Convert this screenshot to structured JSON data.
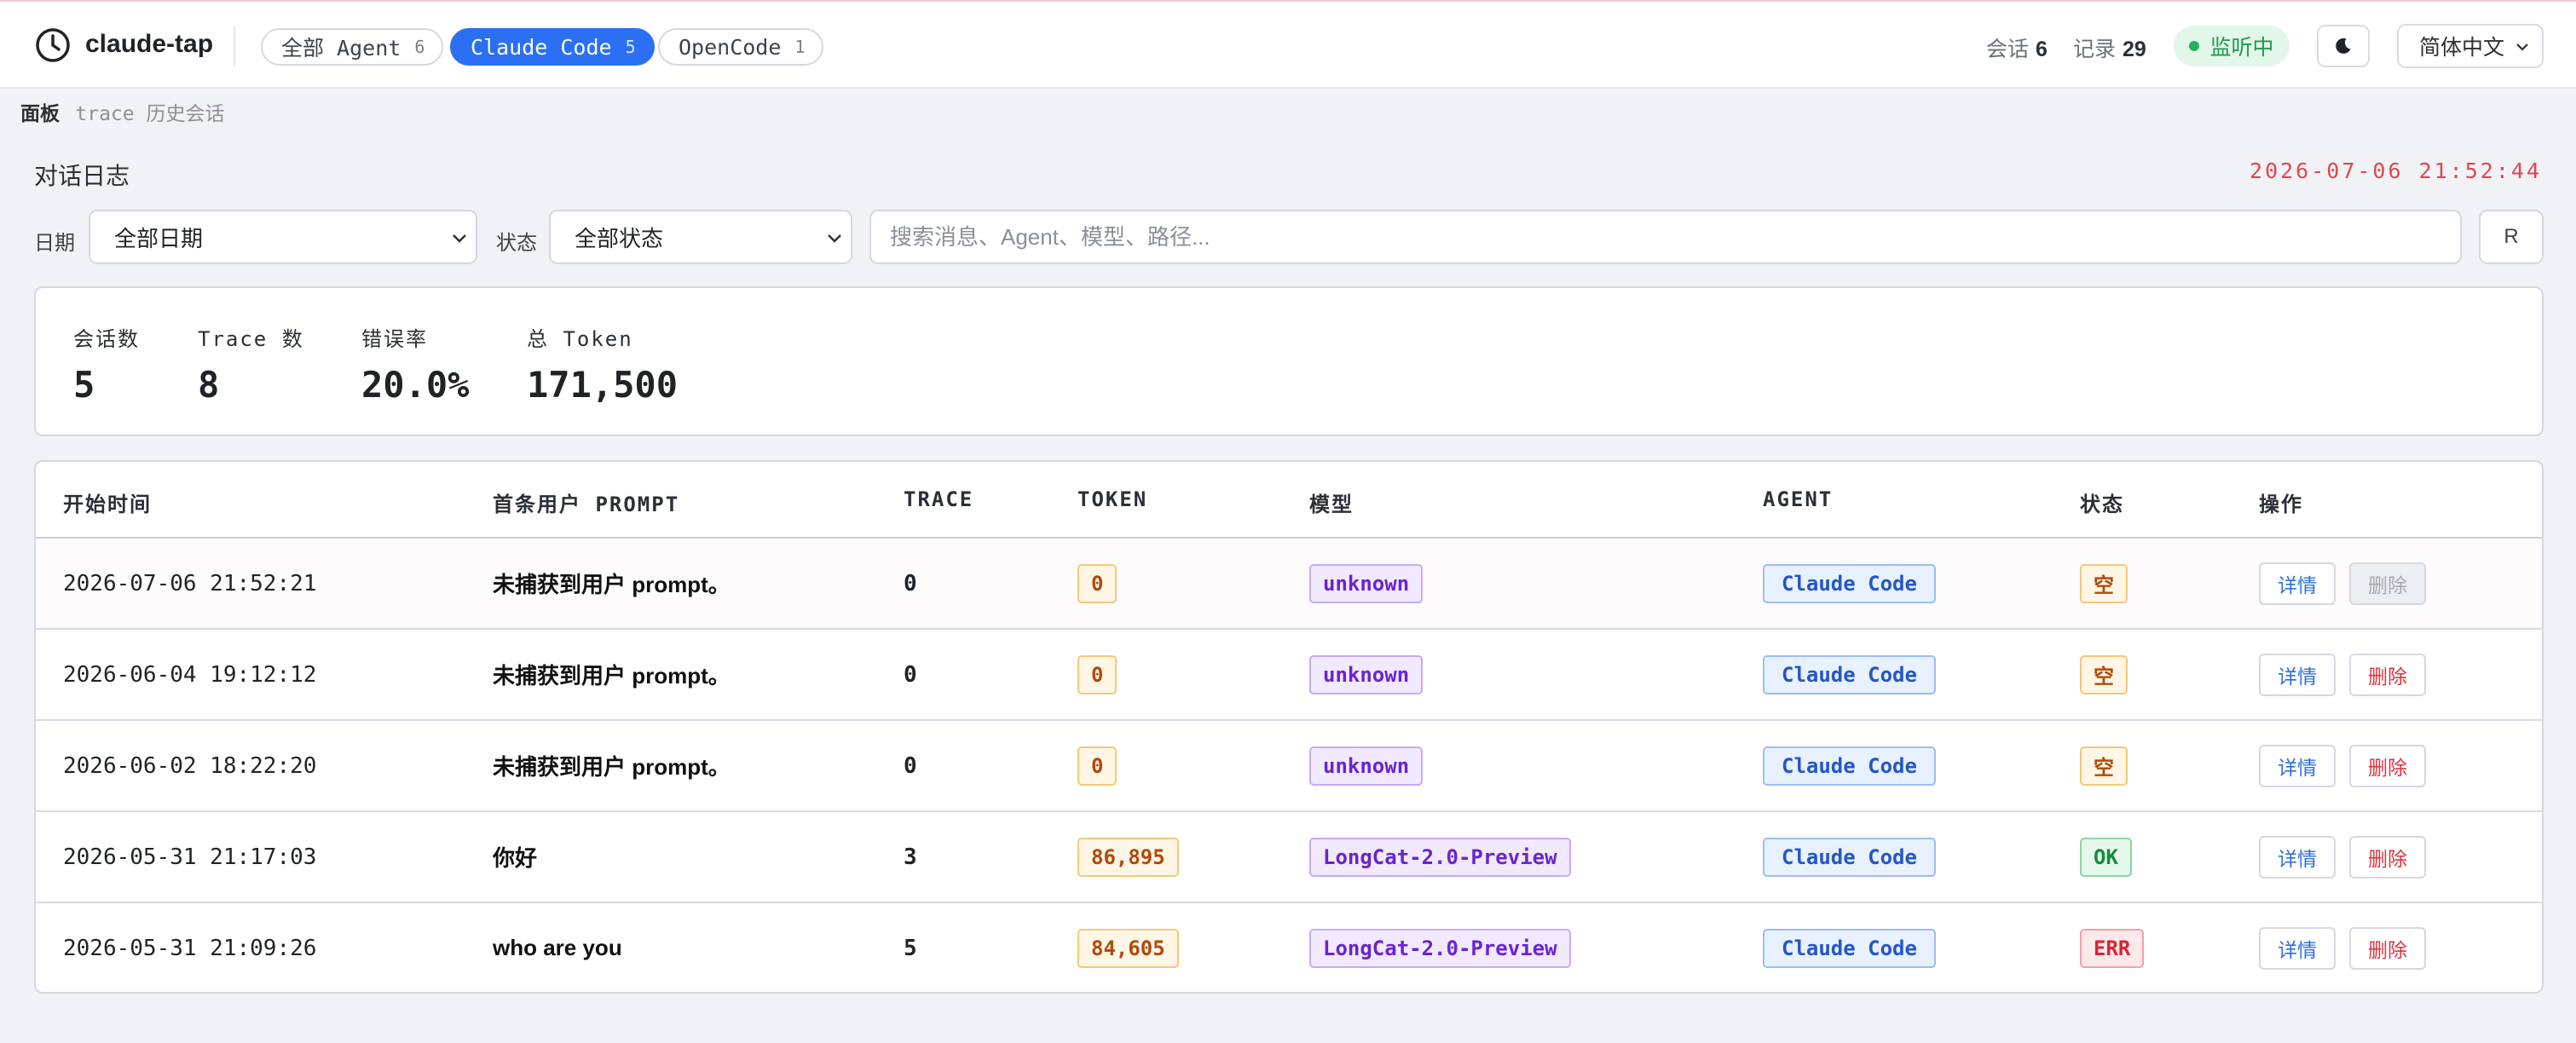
{
  "app": {
    "name": "claude-tap"
  },
  "agent_tabs": [
    {
      "label": "全部 Agent",
      "count": "6",
      "active": false
    },
    {
      "label": "Claude Code",
      "count": "5",
      "active": true
    },
    {
      "label": "OpenCode",
      "count": "1",
      "active": false
    }
  ],
  "header": {
    "sessions_label": "会话",
    "sessions_value": "6",
    "records_label": "记录",
    "records_value": "29",
    "live_label": "监听中",
    "language": "简体中文",
    "theme_icon": "moon-icon"
  },
  "breadcrumb": {
    "root": "面板",
    "path": "trace 历史会话"
  },
  "page": {
    "title": "对话日志",
    "clock": "2026-07-06 21:52:44"
  },
  "filters": {
    "date_label": "日期",
    "date_value": "全部日期",
    "status_label": "状态",
    "status_value": "全部状态",
    "search_placeholder": "搜索消息、Agent、模型、路径...",
    "refresh_label": "R"
  },
  "summary": [
    {
      "label": "会话数",
      "value": "5"
    },
    {
      "label": "Trace 数",
      "value": "8"
    },
    {
      "label": "错误率",
      "value": "20.0%"
    },
    {
      "label": "总 Token",
      "value": "171,500"
    }
  ],
  "table": {
    "headers": [
      "开始时间",
      "首条用户 PROMPT",
      "TRACE",
      "TOKEN",
      "模型",
      "AGENT",
      "状态",
      "操作"
    ],
    "rows": [
      {
        "time": "2026-07-06 21:52:21",
        "prompt": "未捕获到用户 prompt。",
        "trace": "0",
        "token": "0",
        "model": "unknown",
        "agent": "Claude Code",
        "status": "空",
        "detail": "详情",
        "delete": "删除"
      },
      {
        "time": "2026-06-04 19:12:12",
        "prompt": "未捕获到用户 prompt。",
        "trace": "0",
        "token": "0",
        "model": "unknown",
        "agent": "Claude Code",
        "status": "空",
        "detail": "详情",
        "delete": "删除"
      },
      {
        "time": "2026-06-02 18:22:20",
        "prompt": "未捕获到用户 prompt。",
        "trace": "0",
        "token": "0",
        "model": "unknown",
        "agent": "Claude Code",
        "status": "空",
        "detail": "详情",
        "delete": "删除"
      },
      {
        "time": "2026-05-31 21:17:03",
        "prompt": "你好",
        "trace": "3",
        "token": "86,895",
        "model": "LongCat-2.0-Preview",
        "agent": "Claude Code",
        "status": "OK",
        "detail": "详情",
        "delete": "删除"
      },
      {
        "time": "2026-05-31 21:09:26",
        "prompt": "who are you",
        "trace": "5",
        "token": "84,605",
        "model": "LongCat-2.0-Preview",
        "agent": "Claude Code",
        "status": "ERR",
        "detail": "详情",
        "delete": "删除"
      }
    ]
  },
  "colors": {
    "accent": "#2b6ff3",
    "live": "#22b35a",
    "clock": "#e0464d"
  }
}
